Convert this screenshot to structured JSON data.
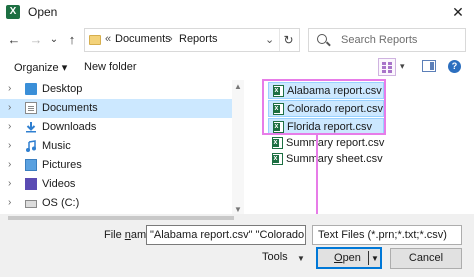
{
  "window": {
    "title": "Open",
    "app_icon": "excel-icon",
    "close_glyph": "✕"
  },
  "nav": {
    "back_glyph": "←",
    "forward_glyph": "→",
    "recent_glyph": "⌄",
    "up_glyph": "↑",
    "breadcrumb_overflow": "«",
    "crumbs": [
      "Documents",
      "Reports"
    ],
    "crumb_sep": "›",
    "dropdown_glyph": "⌄",
    "refresh_glyph": "↻",
    "search_placeholder": "Search Reports"
  },
  "toolbar": {
    "organize_label": "Organize ▾",
    "new_folder_label": "New folder",
    "view_dropdown_glyph": "▾",
    "help_glyph": "?"
  },
  "nav_pane": {
    "items": [
      {
        "label": "Desktop",
        "icon": "desktop-icon",
        "chevron": "›"
      },
      {
        "label": "Documents",
        "icon": "documents-icon",
        "chevron": "›",
        "selected": true
      },
      {
        "label": "Downloads",
        "icon": "download-icon",
        "chevron": "›"
      },
      {
        "label": "Music",
        "icon": "music-icon",
        "chevron": "›"
      },
      {
        "label": "Pictures",
        "icon": "pictures-icon",
        "chevron": "›"
      },
      {
        "label": "Videos",
        "icon": "videos-icon",
        "chevron": "›"
      },
      {
        "label": "OS (C:)",
        "icon": "drive-icon",
        "chevron": "›"
      }
    ]
  },
  "files": [
    {
      "name": "Alabama report.csv",
      "selected": true
    },
    {
      "name": "Colorado report.csv",
      "selected": true
    },
    {
      "name": "Florida report.csv",
      "selected": true
    },
    {
      "name": "Summary report.csv",
      "selected": false
    },
    {
      "name": "Summary sheet.csv",
      "selected": false
    }
  ],
  "bottom": {
    "file_name_label_pre": "File ",
    "file_name_label_u": "n",
    "file_name_label_post": "ame:",
    "file_name_value": "\"Alabama report.csv\" \"Colorado rep",
    "file_type_value": "Text Files (*.prn;*.txt;*.csv)",
    "tools_label": "Tools",
    "tools_dd": "▼",
    "open_u": "O",
    "open_rest": "pen",
    "open_dd": "▼",
    "cancel_label": "Cancel"
  },
  "colors": {
    "highlight": "#e77ce8",
    "selection": "#cce8ff",
    "excel_green": "#1d6f42",
    "accent_blue": "#0078d7"
  }
}
